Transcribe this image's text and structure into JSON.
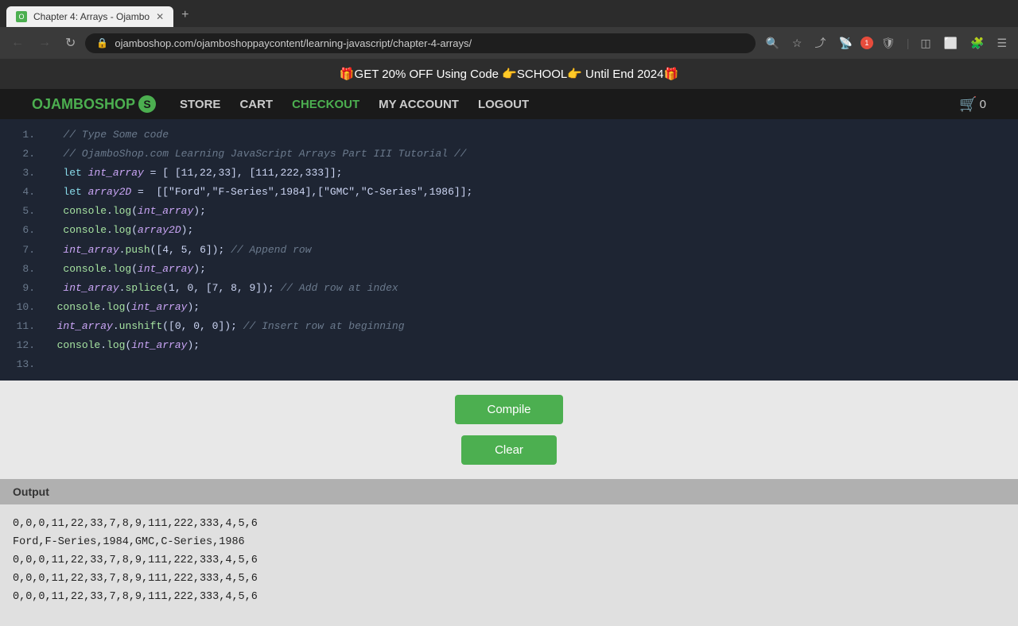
{
  "browser": {
    "tab_title": "Chapter 4: Arrays - Ojambo",
    "tab_favicon": "O",
    "new_tab_label": "+",
    "back_btn": "←",
    "forward_btn": "→",
    "refresh_btn": "↻",
    "address": "ojamboshop.com/ojamboshoppaycontent/learning-javascript/chapter-4-arrays/",
    "window_controls": [
      "—",
      "□",
      "×"
    ]
  },
  "promo": {
    "text": "🎁GET 20% OFF Using Code 👉SCHOOL👉 Until End 2024🎁"
  },
  "nav": {
    "logo": "OJAMBOSHOP",
    "logo_s": "S",
    "links": [
      {
        "label": "STORE",
        "active": false
      },
      {
        "label": "CART",
        "active": false
      },
      {
        "label": "CHECKOUT",
        "active": true
      },
      {
        "label": "MY ACCOUNT",
        "active": false
      },
      {
        "label": "LOGOUT",
        "active": false
      }
    ],
    "cart_icon": "🛒",
    "cart_count": "0"
  },
  "code": {
    "lines": [
      {
        "num": "1.",
        "content": "   // Type Some code"
      },
      {
        "num": "2.",
        "content": "   // OjamboShop.com Learning JavaScript Arrays Part III Tutorial //"
      },
      {
        "num": "3.",
        "content": "   let int_array = [ [11,22,33], [111,222,333]];"
      },
      {
        "num": "4.",
        "content": "   let array2D =  [[\"Ford\",\"F-Series\",1984],[\"GMC\",\"C-Series\",1986]];"
      },
      {
        "num": "5.",
        "content": "   console.log(int_array);"
      },
      {
        "num": "6.",
        "content": "   console.log(array2D);"
      },
      {
        "num": "7.",
        "content": "   int_array.push([4, 5, 6]); // Append row"
      },
      {
        "num": "8.",
        "content": "   console.log(int_array);"
      },
      {
        "num": "9.",
        "content": "   int_array.splice(1, 0, [7, 8, 9]); // Add row at index"
      },
      {
        "num": "10.",
        "content": "  console.log(int_array);"
      },
      {
        "num": "11.",
        "content": "  int_array.unshift([0, 0, 0]); // Insert row at beginning"
      },
      {
        "num": "12.",
        "content": "  console.log(int_array);"
      },
      {
        "num": "13.",
        "content": ""
      }
    ]
  },
  "buttons": {
    "compile_label": "Compile",
    "clear_label": "Clear"
  },
  "output": {
    "header": "Output",
    "lines": [
      "0,0,0,11,22,33,7,8,9,111,222,333,4,5,6",
      "Ford,F-Series,1984,GMC,C-Series,1986",
      "0,0,0,11,22,33,7,8,9,111,222,333,4,5,6",
      "0,0,0,11,22,33,7,8,9,111,222,333,4,5,6",
      "0,0,0,11,22,33,7,8,9,111,222,333,4,5,6"
    ]
  }
}
